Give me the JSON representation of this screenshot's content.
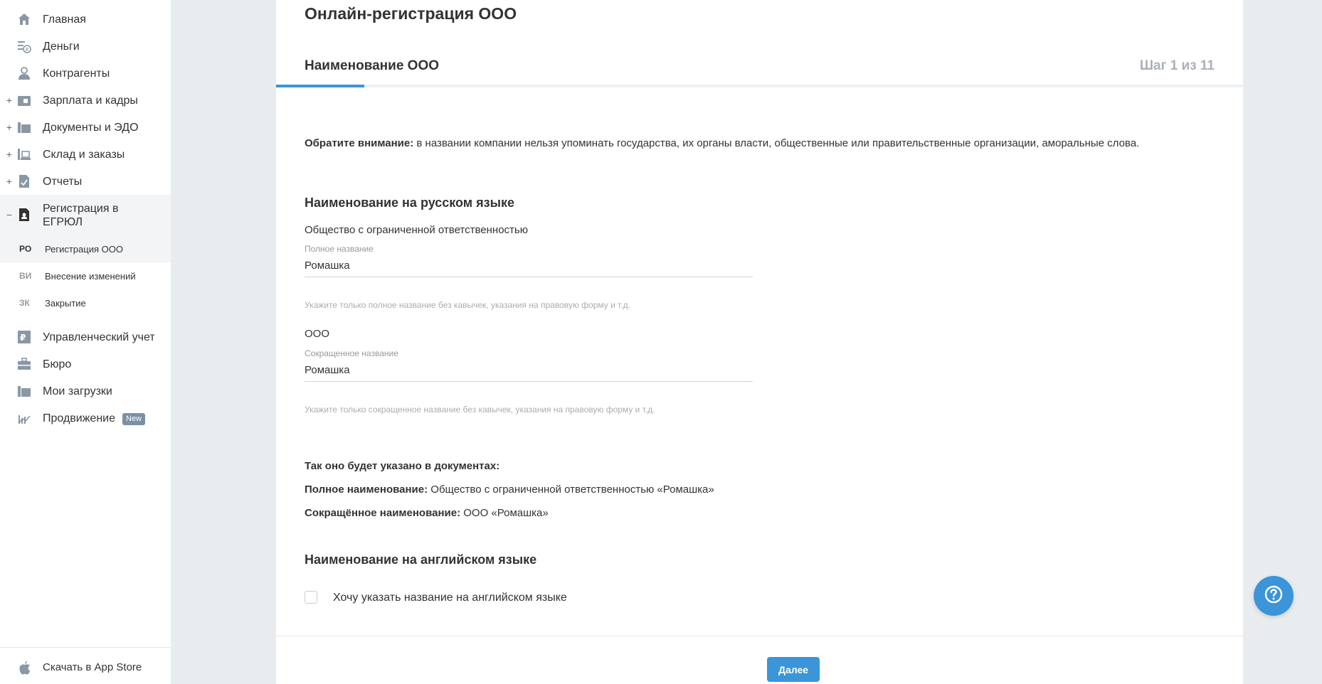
{
  "sidebar": {
    "items": [
      {
        "label": "Главная",
        "icon": "home-icon"
      },
      {
        "label": "Деньги",
        "icon": "money-icon"
      },
      {
        "label": "Контрагенты",
        "icon": "contractors-icon"
      },
      {
        "label": "Зарплата и кадры",
        "icon": "salary-icon",
        "expand": "+"
      },
      {
        "label": "Документы и ЭДО",
        "icon": "documents-icon",
        "expand": "+"
      },
      {
        "label": "Склад и заказы",
        "icon": "warehouse-icon",
        "expand": "+"
      },
      {
        "label": "Отчеты",
        "icon": "reports-icon",
        "expand": "+"
      },
      {
        "label": "Регистрация в ЕГРЮЛ",
        "icon": "registration-icon",
        "expand": "−"
      }
    ],
    "subitems": [
      {
        "abbr": "РО",
        "label": "Регистрация ООО"
      },
      {
        "abbr": "ВИ",
        "label": "Внесение изменений"
      },
      {
        "abbr": "ЗК",
        "label": "Закрытие"
      }
    ],
    "items2": [
      {
        "label": "Управленческий учет",
        "icon": "management-accounting-icon"
      },
      {
        "label": "Бюро",
        "icon": "briefcase-icon"
      },
      {
        "label": "Мои загрузки",
        "icon": "folder-icon"
      },
      {
        "label": "Продвижение",
        "icon": "chart-icon",
        "badge": "New"
      }
    ],
    "appstore": "Скачать в App Store"
  },
  "main": {
    "page_title": "Онлайн-регистрация ООО",
    "step_title": "Наименование ООО",
    "step_count": "Шаг 1 из 11",
    "progress": 0.0909,
    "notice_bold": "Обратите внимание:",
    "notice_text": " в названии компании нельзя упоминать государства, их органы власти, общественные или правительственные организации, аморальные слова.",
    "ru_section": "Наименование на русском языке",
    "full_form": "Общество с ограниченной ответственностью",
    "full_name_label": "Полное название",
    "full_name_value": "Ромашка",
    "full_name_hint": "Укажите только полное название без кавычек, указания на правовую форму и т.д.",
    "short_form": "ООО",
    "short_name_label": "Сокращенное название",
    "short_name_value": "Ромашка",
    "short_name_hint": "Укажите только сокращенное название без кавычек, указания на правовую форму и т.д.",
    "docs_heading": "Так оно будет указано в документах:",
    "docs_full_label": "Полное наименование:",
    "docs_full_value": " Общество с ограниченной ответственностью «Ромашка»",
    "docs_short_label": "Сокращённое наименование:",
    "docs_short_value": " ООО «Ромашка»",
    "en_section": "Наименование на английском языке",
    "en_checkbox_label": "Хочу указать название на английском языке",
    "en_checkbox_checked": false,
    "next_button": "Далее"
  },
  "colors": {
    "accent": "#3b95d8",
    "background": "#e8ecef",
    "icon": "#8a97a5"
  }
}
